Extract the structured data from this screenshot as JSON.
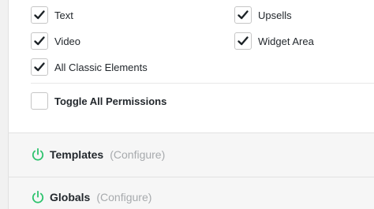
{
  "permissions": {
    "items": [
      {
        "label": "Text",
        "checked": true
      },
      {
        "label": "Upsells",
        "checked": true
      },
      {
        "label": "Video",
        "checked": true
      },
      {
        "label": "Widget Area",
        "checked": true
      },
      {
        "label": "All Classic Elements",
        "checked": true
      }
    ],
    "toggle_all": {
      "label": "Toggle All Permissions",
      "checked": false
    }
  },
  "sections": [
    {
      "title": "Templates",
      "configure": "(Configure)"
    },
    {
      "title": "Globals",
      "configure": "(Configure)"
    }
  ],
  "colors": {
    "accent": "#2ec36e",
    "check": "#1d2327"
  }
}
